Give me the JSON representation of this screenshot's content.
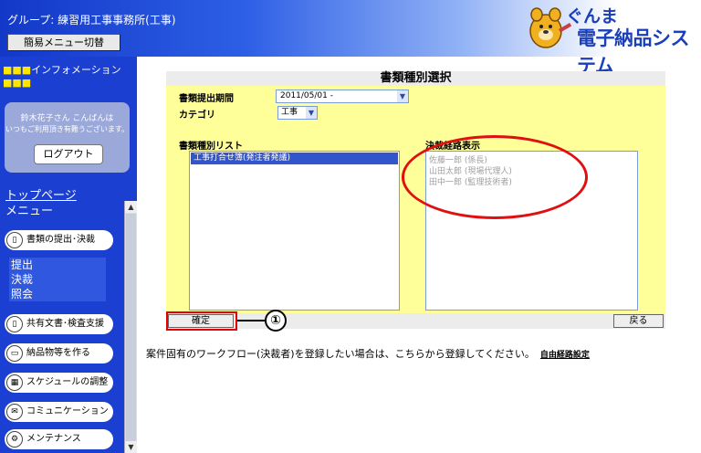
{
  "header": {
    "group": "グループ: 練習用工事事務所(工事)",
    "simple_menu_button": "簡易メニュー切替",
    "logo_line1": "ぐんま",
    "logo_line2": "電子納品システム"
  },
  "sidebar": {
    "info_title": "インフォメーション",
    "greeting_name": "鈴木花子さん こんばんは",
    "greeting_msg": "いつもご利用頂き有難うございます。",
    "logout_button": "ログアウト",
    "top_page": "トップページ",
    "menu_heading": "メニュー",
    "menu": [
      {
        "label": "書類の提出･決裁",
        "icon": "document-icon"
      },
      {
        "label": "共有文書･検査支援",
        "icon": "document-icon"
      },
      {
        "label": "納品物等を作る",
        "icon": "folder-icon"
      },
      {
        "label": "スケジュールの調整",
        "icon": "calendar-icon"
      },
      {
        "label": "コミュニケーション",
        "icon": "mail-icon"
      },
      {
        "label": "メンテナンス",
        "icon": "wrench-icon"
      }
    ],
    "sub_items": [
      "提出",
      "決裁",
      "照会"
    ]
  },
  "main": {
    "title": "書類種別選択",
    "period_label": "書類提出期間",
    "period_value": "2011/05/01 -",
    "category_label": "カテゴリ",
    "category_value": "工事",
    "list_label": "書類種別リスト",
    "list_items": [
      "工事打合せ簿(発注者発議)"
    ],
    "route_label": "決裁経路表示",
    "route_items": [
      "佐藤一郎 (係長)",
      "山田太郎 (現場代理人)",
      "田中一郎 (監理技術者)"
    ],
    "confirm_button": "確定",
    "back_button": "戻る",
    "callout_number": "①"
  },
  "footer": {
    "text": "案件固有のワークフロー(決裁者)を登録したい場合は、こちらから登録してください。",
    "link": "自由経路設定"
  },
  "colors": {
    "sidebar": "#1b3fd1",
    "panel": "#ffff99",
    "selected": "#3355cc",
    "highlight": "#e30000"
  }
}
